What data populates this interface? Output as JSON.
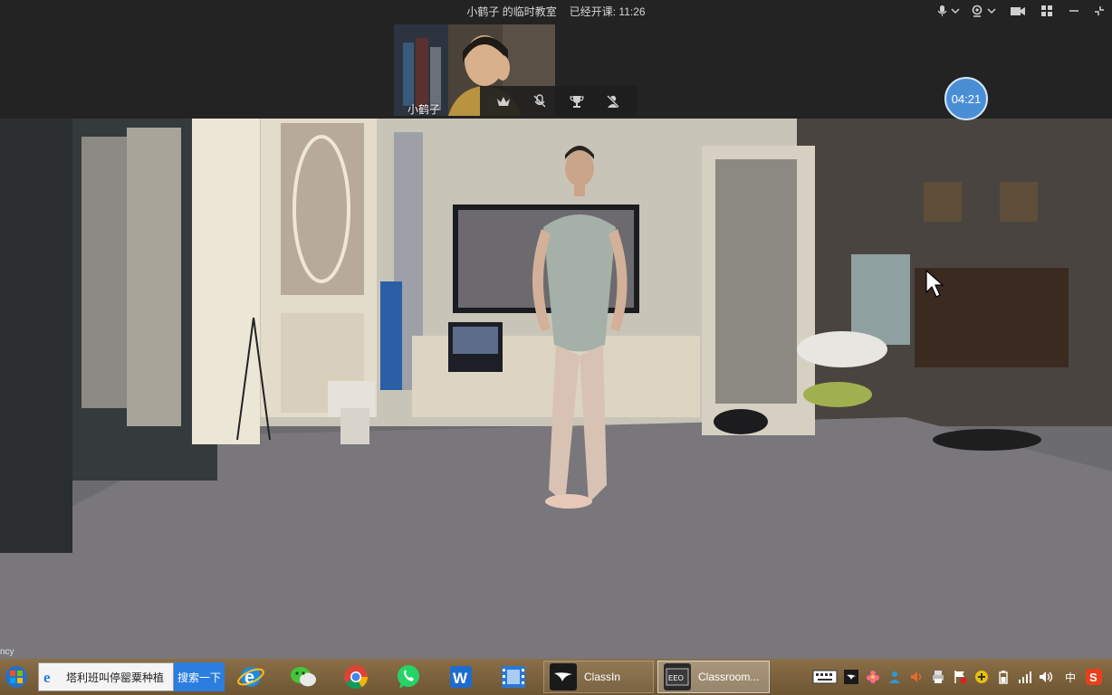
{
  "window": {
    "title": "小鹤子 的临时教室",
    "elapsed_label": "已经开课: 11:26"
  },
  "camera": {
    "name": "小鹤子"
  },
  "timer": {
    "value": "04:21"
  },
  "stage": {
    "corner_text": "ncy"
  },
  "taskbar": {
    "search_text": "塔利班叫停罂粟种植",
    "search_button": "搜索一下",
    "tasks": [
      {
        "label": "ClassIn"
      },
      {
        "label": "Classroom..."
      }
    ],
    "ime_label": "中"
  },
  "colors": {
    "accent": "#2b7de0",
    "timer": "#4a8fd6",
    "topbar": "#232323"
  }
}
